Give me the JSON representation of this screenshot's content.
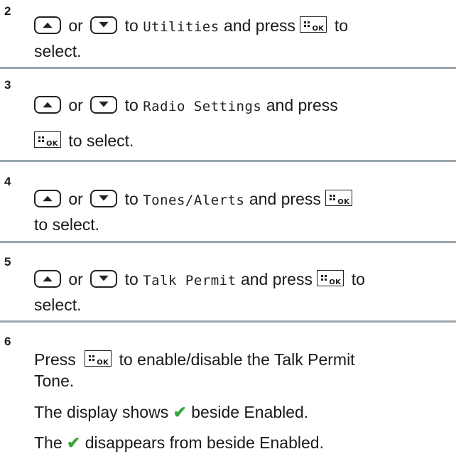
{
  "steps": [
    {
      "number": "2",
      "word_or": "or",
      "word_to": "to",
      "menu_item": "Utilities",
      "text_and_press": "and press",
      "text_to": "to",
      "text_select": "select."
    },
    {
      "number": "3",
      "word_or": "or",
      "word_to": "to",
      "menu_item": "Radio Settings",
      "text_and_press": "and press",
      "text_to_select": "to select."
    },
    {
      "number": "4",
      "word_or": "or",
      "word_to": "to",
      "menu_item": "Tones/Alerts",
      "text_and_press": "and press",
      "text_to_select": "to select."
    },
    {
      "number": "5",
      "word_or": "or",
      "word_to": "to",
      "menu_item": "Talk Permit",
      "text_and_press": "and press",
      "text_to": "to",
      "text_select": "select."
    },
    {
      "number": "6",
      "text_press": "Press",
      "text_enable": "to enable/disable the Talk Permit",
      "text_tone": "Tone.",
      "result_enabled_pre": "The display shows",
      "result_enabled_post": "beside Enabled.",
      "result_disabled_pre": "The",
      "result_disabled_post": "disappears from beside Enabled.",
      "check_glyph": "✔"
    }
  ],
  "keys": {
    "up_icon": "up-arrow-key-icon",
    "down_icon": "down-arrow-key-icon",
    "ok_label": "OK"
  },
  "colors": {
    "divider": "#9ba7ad",
    "check": "#3aa63a"
  }
}
